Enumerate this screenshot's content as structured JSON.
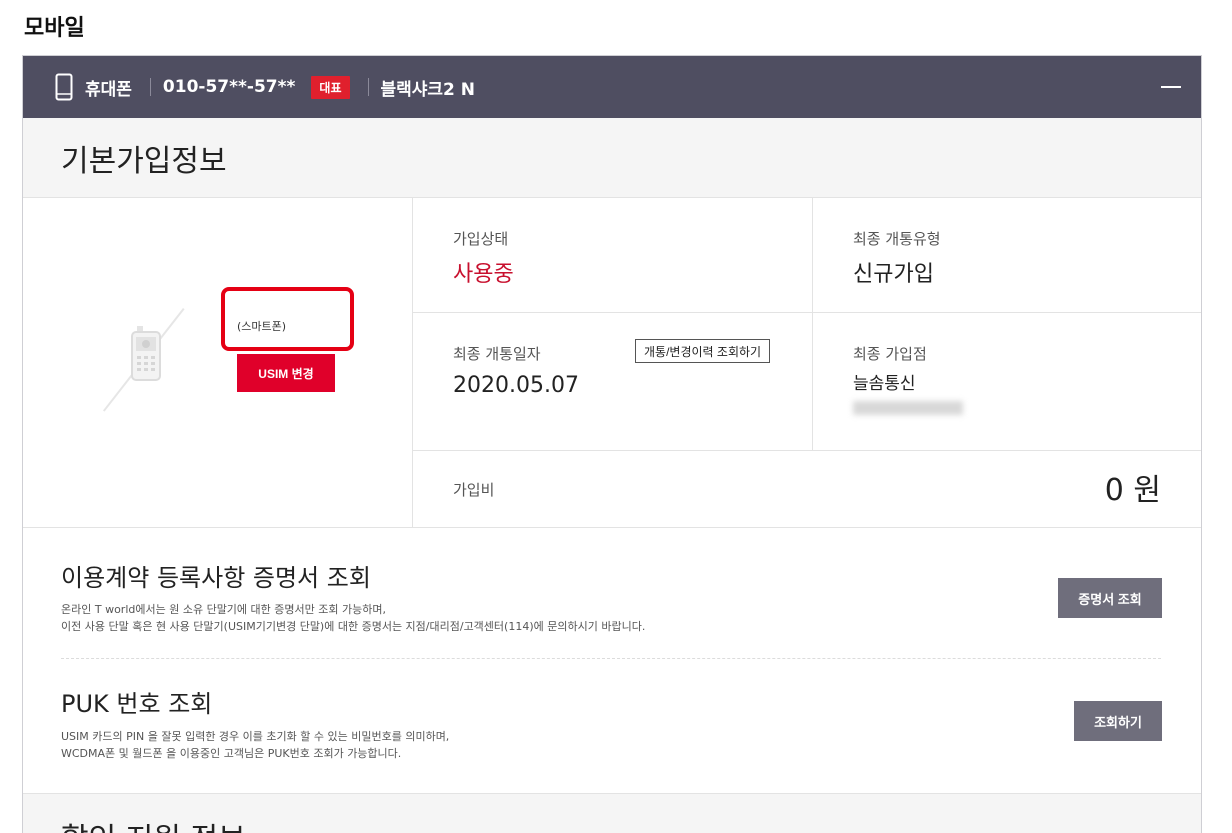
{
  "page": {
    "title": "모바일"
  },
  "header": {
    "device_type": "휴대폰",
    "phone_number": "010-57**-57**",
    "badge": "대표",
    "model": "블랙샤크2 N"
  },
  "basic_info": {
    "title": "기본가입정보",
    "device_name": "(스마트폰)",
    "usim_button": "USIM 변경",
    "status_label": "가입상태",
    "status_value": "사용중",
    "open_type_label": "최종 개통유형",
    "open_type_value": "신규가입",
    "open_date_label": "최종 개통일자",
    "open_date_value": "2020.05.07",
    "history_button": "개통/변경이력 조회하기",
    "store_label": "최종 가입점",
    "store_value": "늘솜통신",
    "fee_label": "가입비",
    "fee_value": "0 원"
  },
  "certificate": {
    "title": "이용계약 등록사항 증명서 조회",
    "desc_line1": "온라인 T world에서는 원 소유 단말기에 대한 증명서만 조회 가능하며,",
    "desc_line2": "이전 사용 단말 혹은 현 사용 단말기(USIM기기변경 단말)에 대한 증명서는 지점/대리점/고객센터(114)에 문의하시기 바랍니다.",
    "button": "증명서 조회"
  },
  "puk": {
    "title": "PUK 번호 조회",
    "desc_line1": "USIM 카드의 PIN 을 잘못 입력한 경우 이를 초기화 할 수 있는 비밀번호를 의미하며,",
    "desc_line2": "WCDMA폰 및 월드폰 을 이용중인 고객님은 PUK번호 조회가 가능합니다.",
    "button": "조회하기"
  },
  "next_section": {
    "title": "할인 지원 정보"
  },
  "colors": {
    "header_bg": "#4f4e61",
    "accent_red": "#e0002a",
    "status_red": "#c8102e",
    "gray_button": "#6f6e7c"
  }
}
